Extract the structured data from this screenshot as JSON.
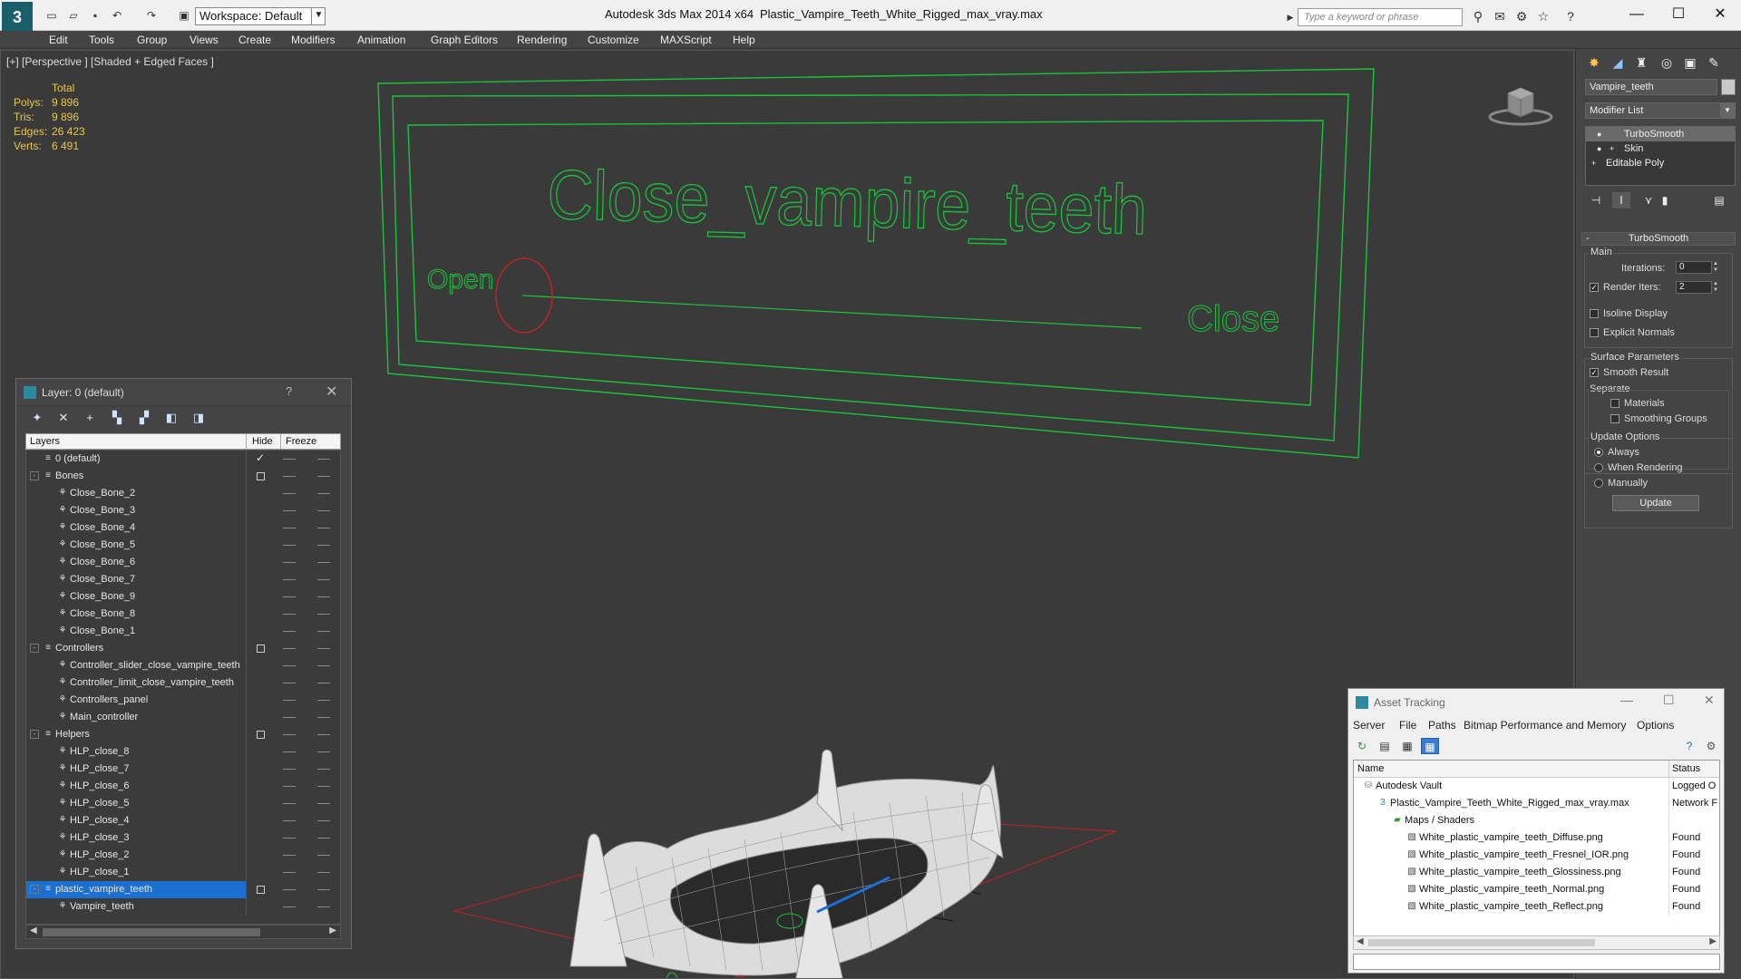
{
  "titlebar": {
    "app_title": "Autodesk 3ds Max  2014 x64",
    "file_title": "Plastic_Vampire_Teeth_White_Rigged_max_vray.max",
    "workspace": "Workspace: Default",
    "search_placeholder": "Type a keyword or phrase"
  },
  "menu": [
    "Edit",
    "Tools",
    "Group",
    "Views",
    "Create",
    "Modifiers",
    "Animation",
    "Graph Editors",
    "Rendering",
    "Customize",
    "MAXScript",
    "Help"
  ],
  "viewport": {
    "label": "[+] [Perspective ] [Shaded + Edged Faces ]",
    "stats": {
      "header": "Total",
      "polys_label": "Polys:",
      "polys": "9 896",
      "tris_label": "Tris:",
      "tris": "9 896",
      "edges_label": "Edges:",
      "edges": "26 423",
      "verts_label": "Verts:",
      "verts": "6 491"
    },
    "scene_text": {
      "title": "Close_vampire_teeth",
      "open": "Open",
      "close": "Close"
    },
    "colors": {
      "controller": "#19c43a",
      "handle": "#d42020",
      "grid": "#c22020"
    }
  },
  "command_panel": {
    "object_name": "Vampire_teeth",
    "modifier_list": "Modifier List",
    "stack": [
      "TurboSmooth",
      "Skin",
      "Editable Poly"
    ],
    "rollout": "TurboSmooth",
    "main_group": "Main",
    "iterations_label": "Iterations:",
    "iterations": "0",
    "render_iters_label": "Render Iters:",
    "render_iters": "2",
    "isoline": "Isoline Display",
    "explicit_normals": "Explicit Normals",
    "surface_group": "Surface Parameters",
    "smooth_result": "Smooth Result",
    "separate": "Separate",
    "materials": "Materials",
    "smoothing_groups": "Smoothing Groups",
    "update_group": "Update Options",
    "always": "Always",
    "when_rendering": "When Rendering",
    "manually": "Manually",
    "update_button": "Update"
  },
  "layer_window": {
    "title": "Layer: 0 (default)",
    "help": "?",
    "columns": {
      "layers": "Layers",
      "hide": "Hide",
      "freeze": "Freeze"
    },
    "rows": [
      {
        "name": "0 (default)",
        "level": 0,
        "type": "layer",
        "current": true
      },
      {
        "name": "Bones",
        "level": 0,
        "type": "layer",
        "expand": "-"
      },
      {
        "name": "Close_Bone_2",
        "level": 1,
        "type": "object"
      },
      {
        "name": "Close_Bone_3",
        "level": 1,
        "type": "object"
      },
      {
        "name": "Close_Bone_4",
        "level": 1,
        "type": "object"
      },
      {
        "name": "Close_Bone_5",
        "level": 1,
        "type": "object"
      },
      {
        "name": "Close_Bone_6",
        "level": 1,
        "type": "object"
      },
      {
        "name": "Close_Bone_7",
        "level": 1,
        "type": "object"
      },
      {
        "name": "Close_Bone_9",
        "level": 1,
        "type": "object"
      },
      {
        "name": "Close_Bone_8",
        "level": 1,
        "type": "object"
      },
      {
        "name": "Close_Bone_1",
        "level": 1,
        "type": "object"
      },
      {
        "name": "Controllers",
        "level": 0,
        "type": "layer",
        "expand": "-"
      },
      {
        "name": "Controller_slider_close_vampire_teeth",
        "level": 1,
        "type": "object"
      },
      {
        "name": "Controller_limit_close_vampire_teeth",
        "level": 1,
        "type": "object"
      },
      {
        "name": "Controllers_panel",
        "level": 1,
        "type": "object"
      },
      {
        "name": "Main_controller",
        "level": 1,
        "type": "object"
      },
      {
        "name": "Helpers",
        "level": 0,
        "type": "layer",
        "expand": "-"
      },
      {
        "name": "HLP_close_8",
        "level": 1,
        "type": "object"
      },
      {
        "name": "HLP_close_7",
        "level": 1,
        "type": "object"
      },
      {
        "name": "HLP_close_6",
        "level": 1,
        "type": "object"
      },
      {
        "name": "HLP_close_5",
        "level": 1,
        "type": "object"
      },
      {
        "name": "HLP_close_4",
        "level": 1,
        "type": "object"
      },
      {
        "name": "HLP_close_3",
        "level": 1,
        "type": "object"
      },
      {
        "name": "HLP_close_2",
        "level": 1,
        "type": "object"
      },
      {
        "name": "HLP_close_1",
        "level": 1,
        "type": "object"
      },
      {
        "name": "plastic_vampire_teeth",
        "level": 0,
        "type": "layer",
        "expand": "-",
        "selected": true
      },
      {
        "name": "Vampire_teeth",
        "level": 1,
        "type": "object"
      }
    ]
  },
  "asset_window": {
    "title": "Asset Tracking",
    "menu": [
      "Server",
      "File",
      "Paths",
      "Bitmap Performance and Memory",
      "Options"
    ],
    "columns": {
      "name": "Name",
      "status": "Status"
    },
    "rows": [
      {
        "name": "Autodesk Vault",
        "level": 0,
        "status": "Logged O"
      },
      {
        "name": "Plastic_Vampire_Teeth_White_Rigged_max_vray.max",
        "level": 1,
        "status": "Network F"
      },
      {
        "name": "Maps / Shaders",
        "level": 2,
        "status": ""
      },
      {
        "name": "White_plastic_vampire_teeth_Diffuse.png",
        "level": 3,
        "status": "Found"
      },
      {
        "name": "White_plastic_vampire_teeth_Fresnel_IOR.png",
        "level": 3,
        "status": "Found"
      },
      {
        "name": "White_plastic_vampire_teeth_Glossiness.png",
        "level": 3,
        "status": "Found"
      },
      {
        "name": "White_plastic_vampire_teeth_Normal.png",
        "level": 3,
        "status": "Found"
      },
      {
        "name": "White_plastic_vampire_teeth_Reflect.png",
        "level": 3,
        "status": "Found"
      }
    ]
  }
}
